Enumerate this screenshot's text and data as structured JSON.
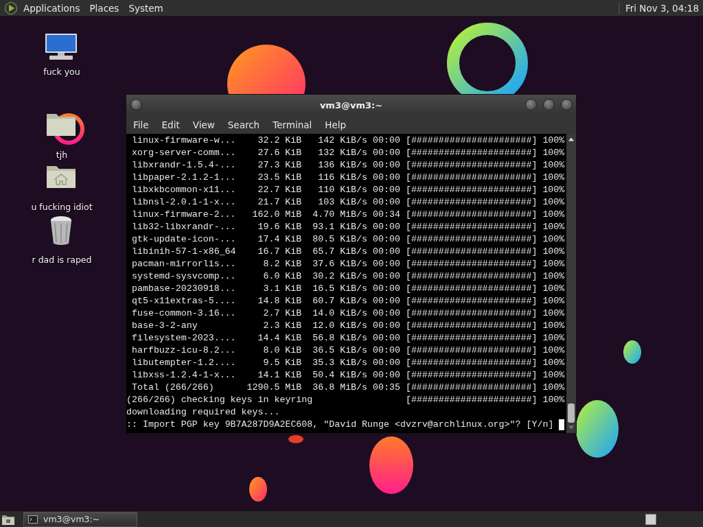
{
  "top_panel": {
    "menus": [
      "Applications",
      "Places",
      "System"
    ],
    "clock": "Fri Nov 3, 04:18"
  },
  "desktop_icons": [
    {
      "kind": "computer",
      "label": "fuck you"
    },
    {
      "kind": "folder",
      "label": "tjh"
    },
    {
      "kind": "home",
      "label": "u fucking idiot"
    },
    {
      "kind": "trash",
      "label": "r dad is raped"
    }
  ],
  "window": {
    "title": "vm3@vm3:~",
    "menu": [
      "File",
      "Edit",
      "View",
      "Search",
      "Terminal",
      "Help"
    ],
    "lines": [
      {
        "kind": "download",
        "name": "linux-firmware-w...",
        "size": "32.2 KiB",
        "speed": "142 KiB/s",
        "time": "00:00",
        "bar": "[######################]",
        "percent": "100%"
      },
      {
        "kind": "download",
        "name": "xorg-server-comm...",
        "size": "27.6 KiB",
        "speed": "132 KiB/s",
        "time": "00:00",
        "bar": "[######################]",
        "percent": "100%"
      },
      {
        "kind": "download",
        "name": "libxrandr-1.5.4-...",
        "size": "27.3 KiB",
        "speed": "136 KiB/s",
        "time": "00:00",
        "bar": "[######################]",
        "percent": "100%"
      },
      {
        "kind": "download",
        "name": "libpaper-2.1.2-1...",
        "size": "23.5 KiB",
        "speed": "116 KiB/s",
        "time": "00:00",
        "bar": "[######################]",
        "percent": "100%"
      },
      {
        "kind": "download",
        "name": "libxkbcommon-x11...",
        "size": "22.7 KiB",
        "speed": "110 KiB/s",
        "time": "00:00",
        "bar": "[######################]",
        "percent": "100%"
      },
      {
        "kind": "download",
        "name": "libnsl-2.0.1-1-x...",
        "size": "21.7 KiB",
        "speed": "103 KiB/s",
        "time": "00:00",
        "bar": "[######################]",
        "percent": "100%"
      },
      {
        "kind": "download",
        "name": "linux-firmware-2...",
        "size": "162.0 MiB",
        "speed": "4.70 MiB/s",
        "time": "00:34",
        "bar": "[######################]",
        "percent": "100%"
      },
      {
        "kind": "download",
        "name": "lib32-libxrandr-...",
        "size": "19.6 KiB",
        "speed": "93.1 KiB/s",
        "time": "00:00",
        "bar": "[######################]",
        "percent": "100%"
      },
      {
        "kind": "download",
        "name": "gtk-update-icon-...",
        "size": "17.4 KiB",
        "speed": "80.5 KiB/s",
        "time": "00:00",
        "bar": "[######################]",
        "percent": "100%"
      },
      {
        "kind": "download",
        "name": "libinih-57-1-x86_64",
        "size": "16.7 KiB",
        "speed": "65.7 KiB/s",
        "time": "00:00",
        "bar": "[######################]",
        "percent": "100%"
      },
      {
        "kind": "download",
        "name": "pacman-mirrorlis...",
        "size": "8.2 KiB",
        "speed": "37.6 KiB/s",
        "time": "00:00",
        "bar": "[######################]",
        "percent": "100%"
      },
      {
        "kind": "download",
        "name": "systemd-sysvcomp...",
        "size": "6.0 KiB",
        "speed": "30.2 KiB/s",
        "time": "00:00",
        "bar": "[######################]",
        "percent": "100%"
      },
      {
        "kind": "download",
        "name": "pambase-20230918...",
        "size": "3.1 KiB",
        "speed": "16.5 KiB/s",
        "time": "00:00",
        "bar": "[######################]",
        "percent": "100%"
      },
      {
        "kind": "download",
        "name": "qt5-x11extras-5....",
        "size": "14.8 KiB",
        "speed": "60.7 KiB/s",
        "time": "00:00",
        "bar": "[######################]",
        "percent": "100%"
      },
      {
        "kind": "download",
        "name": "fuse-common-3.16...",
        "size": "2.7 KiB",
        "speed": "14.0 KiB/s",
        "time": "00:00",
        "bar": "[######################]",
        "percent": "100%"
      },
      {
        "kind": "download",
        "name": "base-3-2-any",
        "size": "2.3 KiB",
        "speed": "12.0 KiB/s",
        "time": "00:00",
        "bar": "[######################]",
        "percent": "100%"
      },
      {
        "kind": "download",
        "name": "filesystem-2023....",
        "size": "14.4 KiB",
        "speed": "56.8 KiB/s",
        "time": "00:00",
        "bar": "[######################]",
        "percent": "100%"
      },
      {
        "kind": "download",
        "name": "harfbuzz-icu-8.2...",
        "size": "8.0 KiB",
        "speed": "36.5 KiB/s",
        "time": "00:00",
        "bar": "[######################]",
        "percent": "100%"
      },
      {
        "kind": "download",
        "name": "libutempter-1.2....",
        "size": "9.5 KiB",
        "speed": "35.3 KiB/s",
        "time": "00:00",
        "bar": "[######################]",
        "percent": "100%"
      },
      {
        "kind": "download",
        "name": "libxss-1.2.4-1-x...",
        "size": "14.1 KiB",
        "speed": "50.4 KiB/s",
        "time": "00:00",
        "bar": "[######################]",
        "percent": "100%"
      },
      {
        "kind": "download",
        "name": "Total (266/266)",
        "size": "1290.5 MiB",
        "speed": "36.8 MiB/s",
        "time": "00:35",
        "bar": "[######################]",
        "percent": "100%"
      },
      {
        "kind": "step",
        "text": "(266/266) checking keys in keyring",
        "bar": "[######################]",
        "percent": "100%"
      },
      {
        "kind": "message",
        "text": "downloading required keys..."
      },
      {
        "kind": "prompt",
        "text": ":: Import PGP key 9B7A287D9A2EC608, \"David Runge <dvzrv@archlinux.org>\"? [Y/n]"
      }
    ]
  },
  "taskbar": {
    "tasks": [
      {
        "label": "vm3@vm3:~",
        "selected": false
      }
    ]
  }
}
